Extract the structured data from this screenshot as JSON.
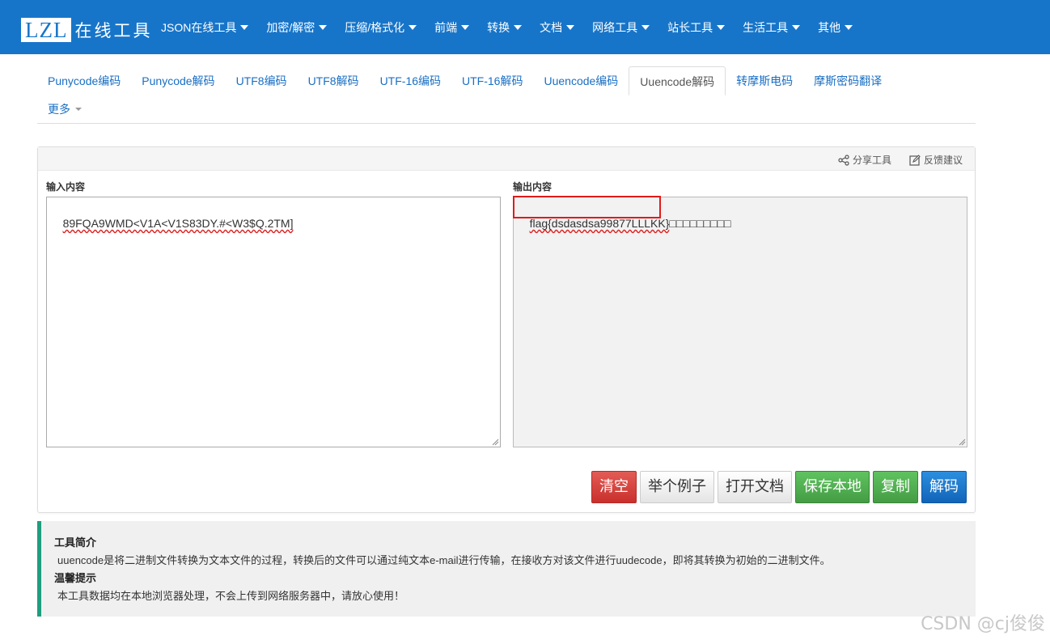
{
  "brand": {
    "logo": "LZL",
    "name": "在线工具"
  },
  "nav": [
    "JSON在线工具",
    "加密/解密",
    "压缩/格式化",
    "前端",
    "转换",
    "文档",
    "网络工具",
    "站长工具",
    "生活工具",
    "其他"
  ],
  "tabs": [
    "Punycode编码",
    "Punycode解码",
    "UTF8编码",
    "UTF8解码",
    "UTF-16编码",
    "UTF-16解码",
    "Uuencode编码",
    "Uuencode解码",
    "转摩斯电码",
    "摩斯密码翻译"
  ],
  "active_tab": "Uuencode解码",
  "more_tab": "更多",
  "panel": {
    "share_label": "分享工具",
    "feedback_label": "反馈建议",
    "input_label": "输入内容",
    "output_label": "输出内容",
    "input_value": "89FQA9WMD<V1A<V1S83DY.#<W3$Q.2TM]",
    "output_flag": "flag{dsdasdsa99877LLLKK}",
    "output_rest": "□□□□□□□□□"
  },
  "buttons": {
    "clear": "清空",
    "example": "举个例子",
    "open_doc": "打开文档",
    "save_local": "保存本地",
    "copy": "复制",
    "decode": "解码"
  },
  "info": {
    "intro_title": "工具简介",
    "intro_text": "uuencode是将二进制文件转换为文本文件的过程，转换后的文件可以通过纯文本e-mail进行传输，在接收方对该文件进行uudecode，即将其转换为初始的二进制文件。",
    "tip_title": "温馨提示",
    "tip_text": "本工具数据均在本地浏览器处理，不会上传到网络服务器中，请放心使用！"
  },
  "watermark": "CSDN @cj俊俊",
  "colors": {
    "navbar": "#1775c9",
    "link": "#1a6fc4",
    "info_border": "#1e9e7e",
    "highlight": "#e21a1a"
  }
}
